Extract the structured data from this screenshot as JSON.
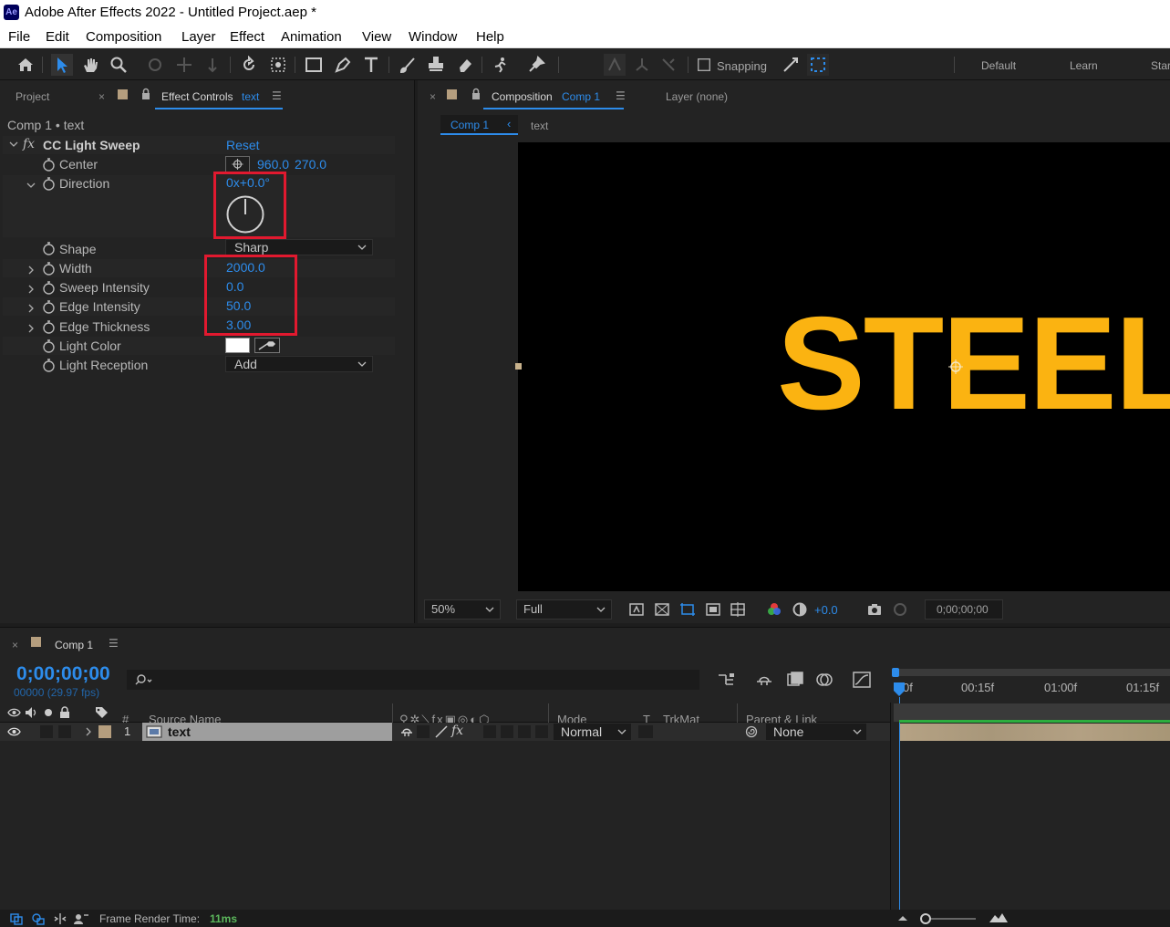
{
  "window": {
    "title": "Adobe After Effects 2022 - Untitled Project.aep *",
    "logo": "Ae"
  },
  "menu": [
    "File",
    "Edit",
    "Composition",
    "Layer",
    "Effect",
    "Animation",
    "View",
    "Window",
    "Help"
  ],
  "toolbar": {
    "snapping_label": "Snapping",
    "workspaces": [
      "Default",
      "Learn",
      "Star"
    ]
  },
  "left_panel": {
    "tabs": {
      "project": "Project",
      "effect_controls": "Effect Controls",
      "effect_controls_target": "text"
    },
    "breadcrumb": "Comp 1 • text",
    "effect": {
      "fx": "fx",
      "name": "CC Light Sweep",
      "reset": "Reset",
      "properties": {
        "center": {
          "label": "Center",
          "x": "960.0",
          "y": "270.0"
        },
        "direction": {
          "label": "Direction",
          "value": "0x+0.0°"
        },
        "shape": {
          "label": "Shape",
          "value": "Sharp"
        },
        "width": {
          "label": "Width",
          "value": "2000.0"
        },
        "sweep_intensity": {
          "label": "Sweep Intensity",
          "value": "0.0"
        },
        "edge_intensity": {
          "label": "Edge Intensity",
          "value": "50.0"
        },
        "edge_thickness": {
          "label": "Edge Thickness",
          "value": "3.00"
        },
        "light_color": {
          "label": "Light Color",
          "color": "#ffffff"
        },
        "light_reception": {
          "label": "Light Reception",
          "value": "Add"
        }
      }
    }
  },
  "comp_panel": {
    "tabs": {
      "composition": "Composition",
      "composition_target": "Comp 1",
      "layer": "Layer (none)"
    },
    "breadcrumbs": [
      "Comp 1",
      "text"
    ],
    "canvas_text": "STEEL",
    "canvas_text_color": "#fbb311",
    "viewer_controls": {
      "zoom": "50%",
      "resolution": "Full",
      "exposure": "+0.0",
      "timecode": "0;00;00;00"
    }
  },
  "timeline": {
    "tab": "Comp 1",
    "timecode": "0;00;00;00",
    "fps": "00000 (29.97 fps)",
    "search_placeholder": "",
    "columns": {
      "hash": "#",
      "source_name": "Source Name",
      "mode": "Mode",
      "t": "T",
      "trkmat": "TrkMat",
      "parent": "Parent & Link"
    },
    "ruler": [
      "0f",
      "00:15f",
      "01:00f",
      "01:15f"
    ],
    "layers": [
      {
        "index": "1",
        "name": "text",
        "mode": "Normal",
        "parent": "None"
      }
    ]
  },
  "status": {
    "label": "Frame Render Time:",
    "value": "11ms"
  },
  "colors": {
    "accent": "#2d8ceb",
    "highlight": "#e1192f",
    "layer_label": "#b59e7e"
  }
}
